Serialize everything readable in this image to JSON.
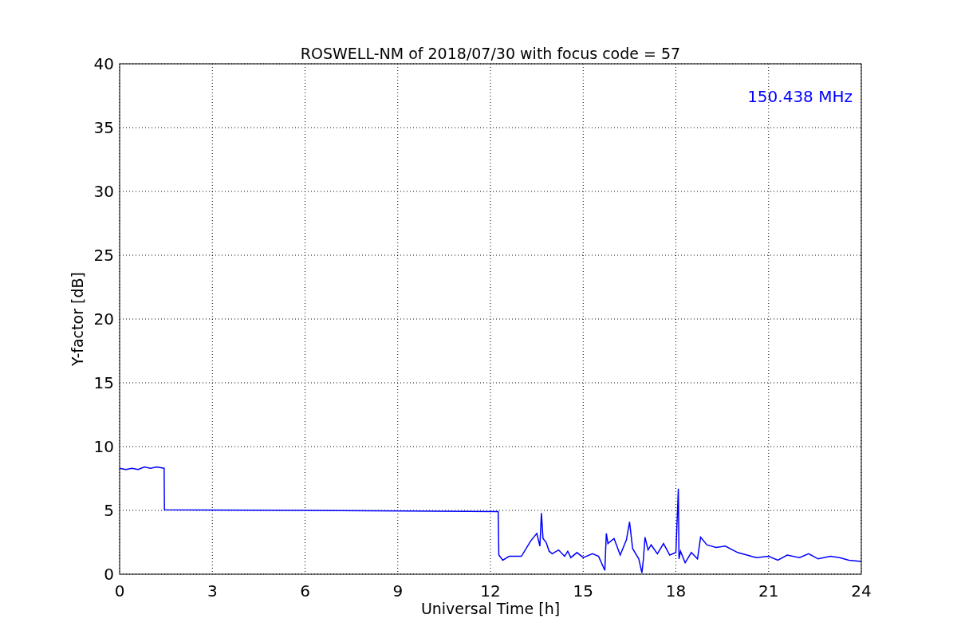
{
  "chart_data": {
    "type": "line",
    "title": "ROSWELL-NM of 2018/07/30 with focus code = 57",
    "xlabel": "Universal Time [h]",
    "ylabel": "Y-factor [dB]",
    "x": [
      0,
      0.2,
      0.4,
      0.6,
      0.8,
      1.0,
      1.2,
      1.44,
      1.45,
      6,
      12.25,
      12.27,
      12.4,
      12.6,
      12.8,
      13.0,
      13.3,
      13.5,
      13.6,
      13.65,
      13.7,
      13.8,
      13.9,
      14.0,
      14.2,
      14.4,
      14.5,
      14.6,
      14.8,
      15.0,
      15.3,
      15.5,
      15.7,
      15.75,
      15.8,
      16.0,
      16.2,
      16.4,
      16.5,
      16.6,
      16.8,
      16.9,
      16.95,
      17.0,
      17.1,
      17.2,
      17.4,
      17.6,
      17.8,
      18.0,
      18.08,
      18.1,
      18.15,
      18.3,
      18.5,
      18.7,
      18.8,
      19.0,
      19.3,
      19.6,
      20.0,
      20.3,
      20.6,
      21.0,
      21.3,
      21.6,
      22.0,
      22.3,
      22.6,
      23.0,
      23.3,
      23.6,
      24.0
    ],
    "series": [
      {
        "name": "150.438 MHz",
        "color": "#0000ff",
        "values": [
          8.3,
          8.2,
          8.3,
          8.2,
          8.4,
          8.3,
          8.4,
          8.3,
          5.05,
          5.0,
          4.9,
          1.5,
          1.1,
          1.4,
          1.4,
          1.4,
          2.6,
          3.2,
          2.2,
          4.8,
          2.8,
          2.5,
          1.8,
          1.6,
          1.9,
          1.4,
          1.8,
          1.3,
          1.7,
          1.3,
          1.6,
          1.4,
          0.3,
          3.2,
          2.4,
          2.8,
          1.5,
          2.7,
          4.1,
          2.0,
          1.2,
          0.1,
          1.2,
          2.9,
          1.9,
          2.3,
          1.6,
          2.4,
          1.5,
          1.7,
          6.7,
          1.2,
          1.8,
          0.9,
          1.7,
          1.2,
          2.9,
          2.3,
          2.1,
          2.2,
          1.7,
          1.5,
          1.3,
          1.4,
          1.1,
          1.5,
          1.3,
          1.6,
          1.2,
          1.4,
          1.3,
          1.1,
          1.0
        ]
      }
    ],
    "xlim": [
      0,
      24
    ],
    "ylim": [
      0,
      40
    ],
    "xticks": [
      0,
      3,
      6,
      9,
      12,
      15,
      18,
      21,
      24
    ],
    "yticks": [
      0,
      5,
      10,
      15,
      20,
      25,
      30,
      35,
      40
    ],
    "grid": true
  }
}
